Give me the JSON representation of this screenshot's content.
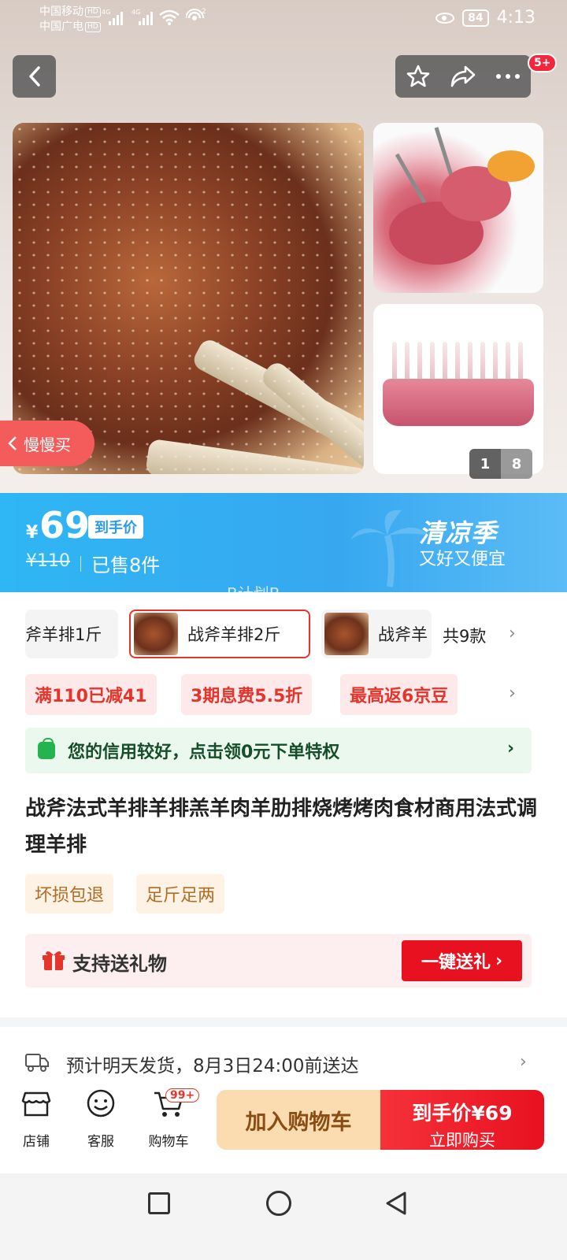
{
  "status": {
    "carrier1": "中国移动",
    "carrier2": "中国广电",
    "hd": "HD",
    "net1": "4G",
    "net2": "4G",
    "battery": "84",
    "time": "4:13"
  },
  "header": {
    "more_badge": "5+"
  },
  "gallery": {
    "slow_buy_label": "慢慢买",
    "page_current": "1",
    "page_total": "8"
  },
  "price": {
    "currency": "¥",
    "amount": "69",
    "tag": "到手价",
    "original": "¥110",
    "sold": "已售8件",
    "season_title": "清凉季",
    "season_sub": "又好又便宜",
    "watermark": "B计划B"
  },
  "variants": {
    "items": [
      "斧羊排1斤",
      "战斧羊排2斤",
      "战斧羊"
    ],
    "count_label": "共9款"
  },
  "promos": [
    "满110已减41",
    "3期息费5.5折",
    "最高返6京豆"
  ],
  "credit": {
    "text": "您的信用较好，点击领0元下单特权"
  },
  "product": {
    "title": "战斧法式羊排羊排羔羊肉羊肋排烧烤烤肉食材商用法式调理羊排",
    "guarantees": [
      "坏损包退",
      "足斤足两"
    ]
  },
  "gift": {
    "label": "支持送礼物",
    "button": "一键送礼"
  },
  "delivery": {
    "text": "预计明天发货，8月3日24:00前送达"
  },
  "actionbar": {
    "shop": "店铺",
    "service": "客服",
    "cart": "购物车",
    "cart_badge": "99+",
    "add_cart": "加入购物车",
    "buy_line1": "到手价¥69",
    "buy_line2": "立即购买"
  },
  "colors": {
    "accent_red": "#e8111f",
    "price_band_blue": "#37a8f0",
    "promo_bg": "#fde8ea",
    "credit_bg": "#eaf8ee",
    "add_cart_bg": "#fbdcb0"
  }
}
